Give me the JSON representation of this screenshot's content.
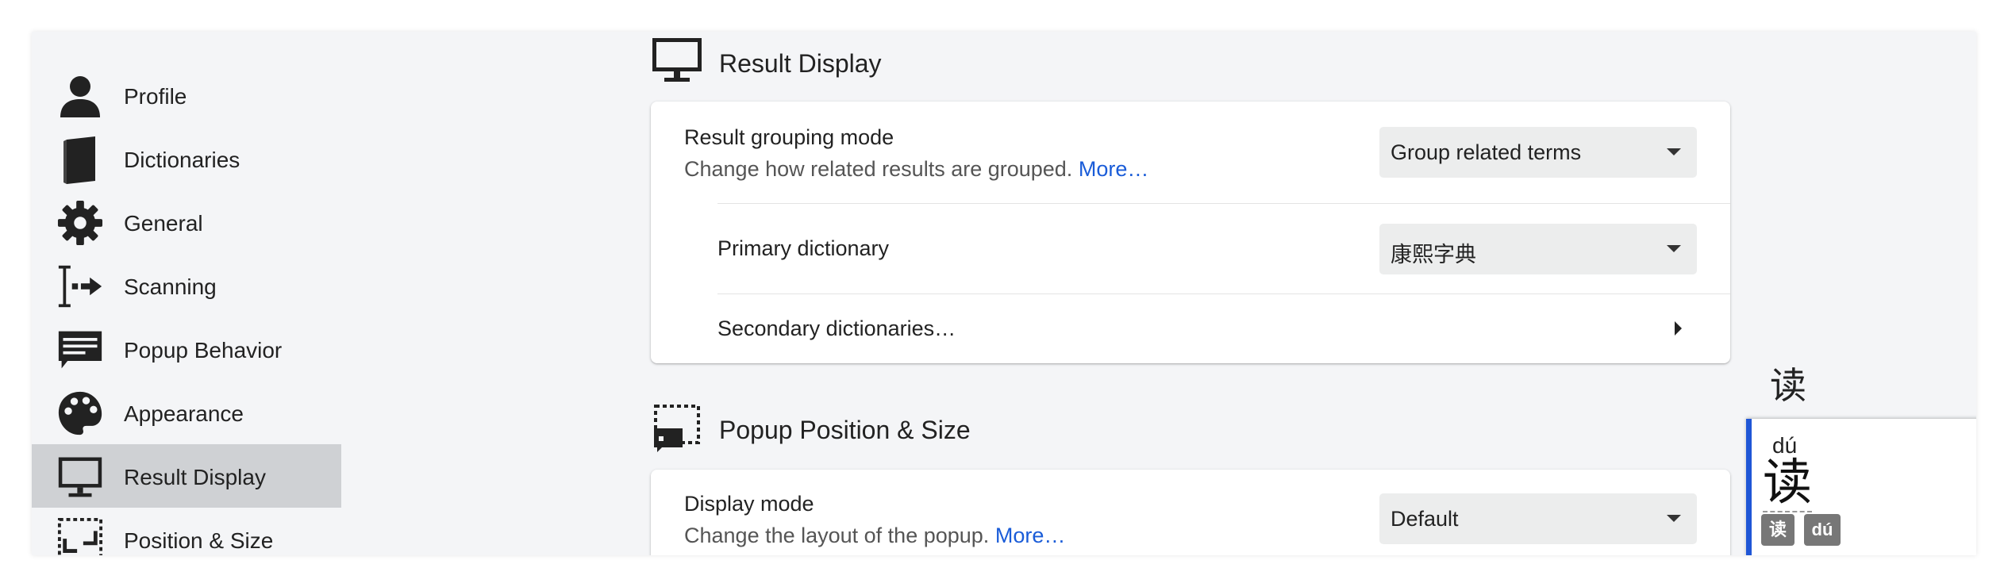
{
  "sidebar": {
    "items": [
      {
        "label": "Profile",
        "icon": "person-icon"
      },
      {
        "label": "Dictionaries",
        "icon": "book-icon"
      },
      {
        "label": "General",
        "icon": "gear-icon"
      },
      {
        "label": "Scanning",
        "icon": "text-cursor-arrow-icon"
      },
      {
        "label": "Popup Behavior",
        "icon": "popup-message-icon"
      },
      {
        "label": "Appearance",
        "icon": "palette-icon"
      },
      {
        "label": "Result Display",
        "icon": "monitor-icon",
        "active": true
      },
      {
        "label": "Position & Size",
        "icon": "resize-frame-icon"
      }
    ]
  },
  "result_display": {
    "title": "Result Display",
    "grouping": {
      "title": "Result grouping mode",
      "description": "Change how related results are grouped.",
      "more": "More…",
      "value": "Group related terms"
    },
    "primary": {
      "title": "Primary dictionary",
      "value": "康熙字典"
    },
    "secondary": {
      "title": "Secondary dictionaries…"
    }
  },
  "popup_position": {
    "title": "Popup Position & Size",
    "display_mode": {
      "title": "Display mode",
      "description": "Change the layout of the popup.",
      "more": "More…",
      "value": "Default"
    }
  },
  "preview": {
    "character": "读",
    "reading": "dú",
    "headword": "读",
    "tags": [
      "读",
      "dú"
    ]
  },
  "colors": {
    "accent": "#1f56d6",
    "link": "#1a5cd8",
    "active_sidebar": "#cfd1d4",
    "background": "#f4f5f7"
  }
}
